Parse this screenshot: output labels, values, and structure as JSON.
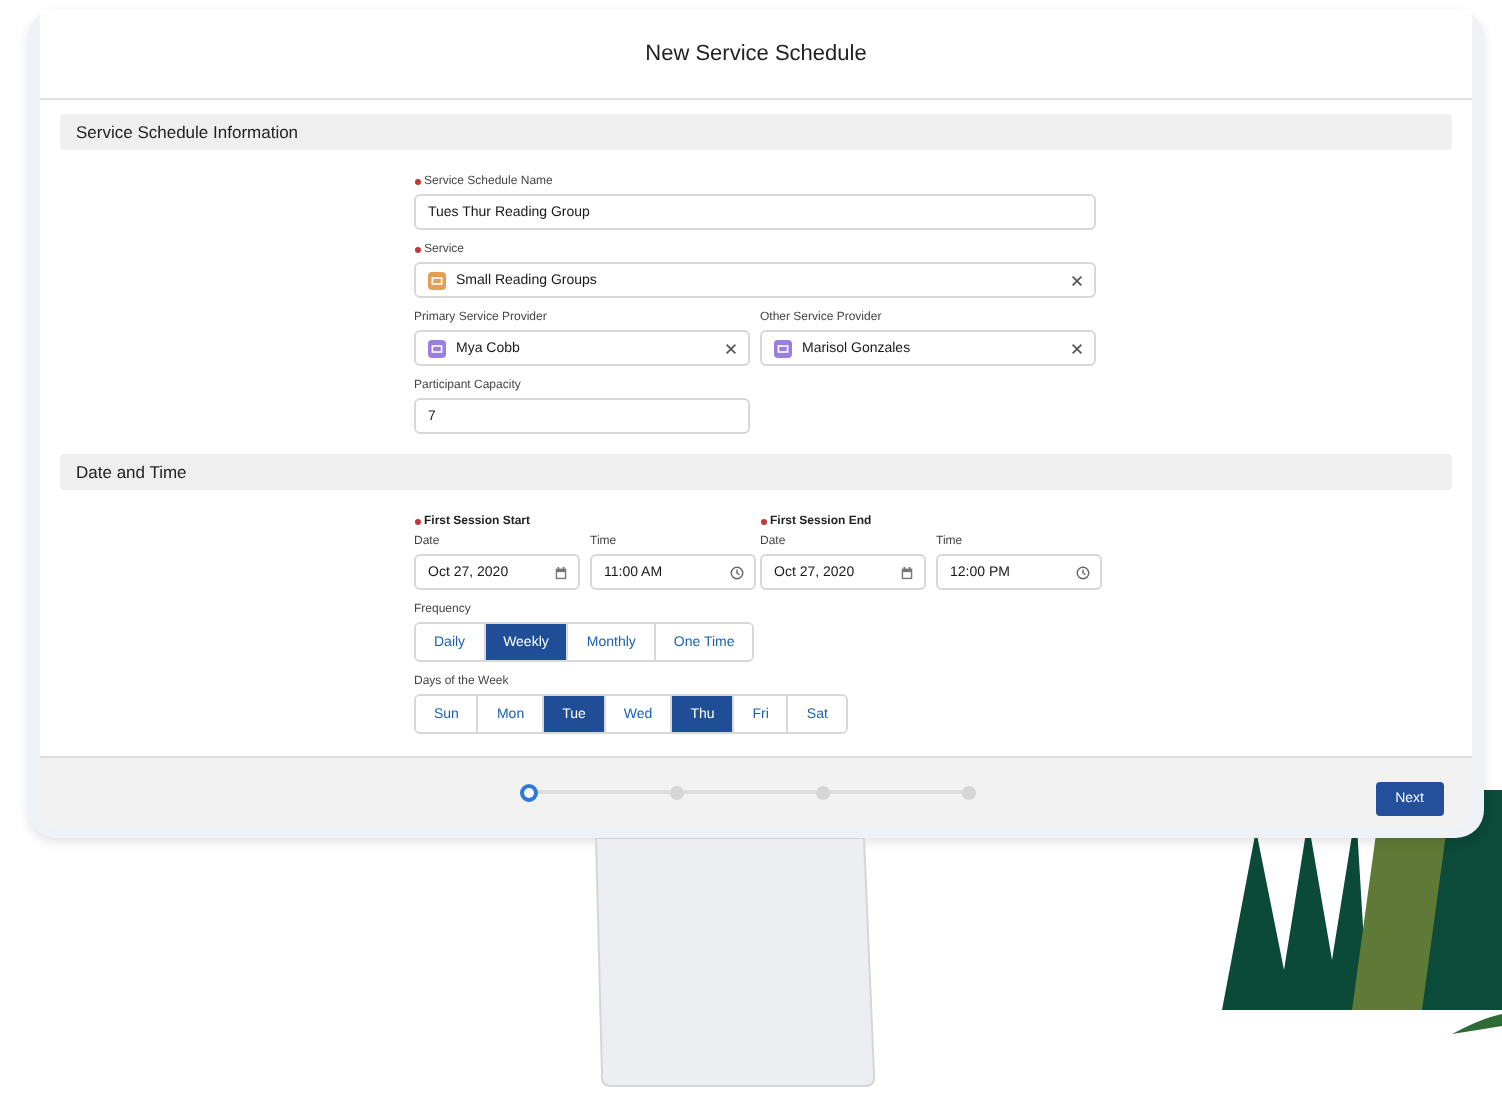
{
  "window": {
    "title": "New Service Schedule"
  },
  "info_section": {
    "title": "Service Schedule Information",
    "rows": [
      [
        {
          "label": "Service Schedule Name",
          "required": true,
          "kind": "text",
          "value": "Tues Thur Reading Group",
          "wide": true
        }
      ],
      [
        {
          "label": "Service",
          "required": true,
          "kind": "lookup",
          "color": "#e3a052",
          "value": "Small Reading Groups",
          "wide": true
        }
      ],
      [
        {
          "label": "Primary Service Provider",
          "required": false,
          "kind": "lookup",
          "color": "#9b7fe0",
          "value": "Mya Cobb",
          "wide": false
        },
        {
          "label": "Other Service Provider",
          "required": false,
          "kind": "lookup",
          "color": "#9b7fe0",
          "value": "Marisol Gonzales",
          "wide": false
        }
      ],
      [
        {
          "label": "Participant Capacity",
          "required": false,
          "kind": "text",
          "value": "7",
          "wide": false
        }
      ]
    ]
  },
  "date_section": {
    "title": "Date and Time",
    "sessions": [
      {
        "label": "First Session Start",
        "required": true,
        "fields": [
          {
            "label": "Date",
            "kind": "date",
            "value": "Oct 27, 2020"
          },
          {
            "label": "Time",
            "kind": "time",
            "value": "11:00 AM"
          }
        ]
      },
      {
        "label": "First Session End",
        "required": true,
        "fields": [
          {
            "label": "Date",
            "kind": "date",
            "value": "Oct 27, 2020"
          },
          {
            "label": "Time",
            "kind": "time",
            "value": "12:00 PM"
          }
        ]
      }
    ],
    "frequency": {
      "label": "Frequency",
      "options": [
        {
          "label": "Daily",
          "selected": false
        },
        {
          "label": "Weekly",
          "selected": true
        },
        {
          "label": "Monthly",
          "selected": false
        },
        {
          "label": "One Time",
          "selected": false
        }
      ]
    },
    "days": {
      "label": "Days of the Week",
      "options": [
        {
          "label": "Sun",
          "selected": false
        },
        {
          "label": "Mon",
          "selected": false
        },
        {
          "label": "Tue",
          "selected": true
        },
        {
          "label": "Wed",
          "selected": false
        },
        {
          "label": "Thu",
          "selected": true
        },
        {
          "label": "Fri",
          "selected": false
        },
        {
          "label": "Sat",
          "selected": false
        }
      ]
    }
  },
  "footer": {
    "steps": [
      {
        "selected": true
      },
      {
        "selected": false
      },
      {
        "selected": false
      },
      {
        "selected": false
      }
    ],
    "next_button": "Next"
  }
}
